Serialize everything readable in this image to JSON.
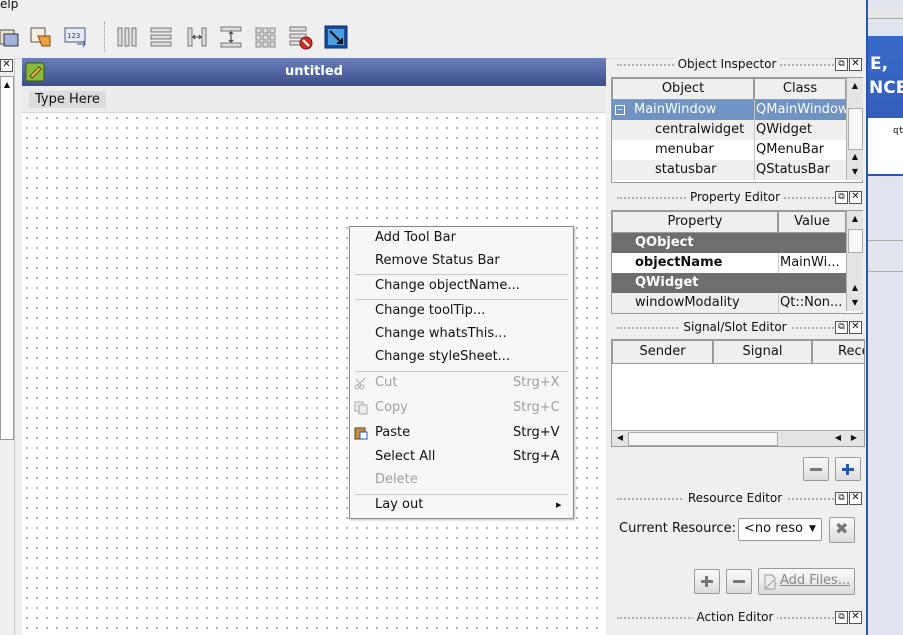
{
  "menubar": {
    "item": "elp"
  },
  "form": {
    "title": "untitled",
    "menu_placeholder": "Type Here"
  },
  "context_menu": {
    "items": [
      {
        "label": "Add Tool Bar"
      },
      {
        "label": "Remove Status Bar"
      },
      {
        "label": "Change objectName..."
      },
      {
        "label": "Change toolTip..."
      },
      {
        "label": "Change whatsThis..."
      },
      {
        "label": "Change styleSheet..."
      },
      {
        "label": "Cut",
        "shortcut": "Strg+X",
        "icon": "scissors-icon"
      },
      {
        "label": "Copy",
        "shortcut": "Strg+C",
        "icon": "copy-icon"
      },
      {
        "label": "Paste",
        "shortcut": "Strg+V",
        "icon": "paste-icon"
      },
      {
        "label": "Select All",
        "shortcut": "Strg+A"
      },
      {
        "label": "Delete"
      },
      {
        "label": "Lay out"
      }
    ],
    "submenu_arrow": "▸"
  },
  "object_inspector": {
    "title": "Object Inspector",
    "columns": [
      "Object",
      "Class"
    ],
    "rows": [
      {
        "object": "MainWindow",
        "class": "QMainWindow"
      },
      {
        "object": "centralwidget",
        "class": "QWidget"
      },
      {
        "object": "menubar",
        "class": "QMenuBar"
      },
      {
        "object": "statusbar",
        "class": "QStatusBar"
      }
    ],
    "collapse_glyph": "−"
  },
  "property_editor": {
    "title": "Property Editor",
    "columns": [
      "Property",
      "Value"
    ],
    "rows": [
      {
        "property": "QObject",
        "value": ""
      },
      {
        "property": "objectName",
        "value": "MainWi..."
      },
      {
        "property": "QWidget",
        "value": ""
      },
      {
        "property": "windowModality",
        "value": "Qt::Non..."
      }
    ]
  },
  "signal_slot_editor": {
    "title": "Signal/Slot Editor",
    "columns": [
      "Sender",
      "Signal",
      "Rece"
    ]
  },
  "resource_editor": {
    "title": "Resource Editor",
    "current_label": "Current Resource:",
    "current_value": "<no reso",
    "add_files_label": "Add Files..."
  },
  "action_editor": {
    "title": "Action Editor"
  },
  "bg_window": {
    "line1": "E,",
    "line2": "NCE",
    "small": "qt"
  },
  "colors": {
    "titlebar": "#3c4f8c",
    "selection": "#6f93c2",
    "category_row": "#6e6e6e",
    "dock_border": "#2a56b0"
  }
}
